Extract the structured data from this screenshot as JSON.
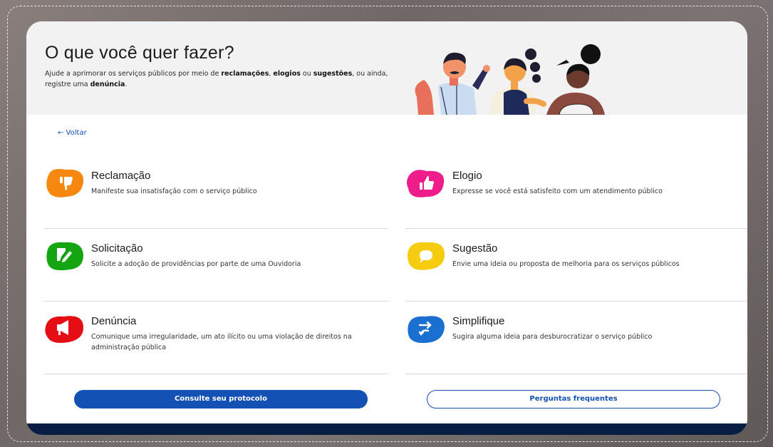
{
  "header": {
    "title": "O que você quer fazer?",
    "subtitle_parts": {
      "p1": "Ajude a aprimorar os serviços públicos por meio de ",
      "b1": "reclamações",
      "p2": ", ",
      "b2": "elogios",
      "p3": " ou ",
      "b3": "sugestões",
      "p4": ", ou ainda, registre uma ",
      "b4": "denúncia",
      "p5": "."
    }
  },
  "nav": {
    "back_label": "← Voltar"
  },
  "options": [
    {
      "title": "Reclamação",
      "description": "Manifeste sua insatisfação com o serviço público",
      "color": "#f7880f",
      "icon": "thumbs-down-icon"
    },
    {
      "title": "Elogio",
      "description": "Expresse se você está satisfeito com um atendimento público",
      "color": "#ef1d8c",
      "icon": "thumbs-up-icon"
    },
    {
      "title": "Solicitação",
      "description": "Solicite a adoção de providências por parte de uma Ouvidoria",
      "color": "#16a512",
      "icon": "document-edit-icon"
    },
    {
      "title": "Sugestão",
      "description": "Envie uma ideia ou proposta de melhoria para os serviços públicos",
      "color": "#f6cc10",
      "icon": "chat-bubble-icon"
    },
    {
      "title": "Denúncia",
      "description": "Comunique uma irregularidade, um ato ilícito ou uma violação de direitos na administração pública",
      "color": "#e40e14",
      "icon": "megaphone-icon"
    },
    {
      "title": "Simplifique",
      "description": "Sugira alguma ideia para desburocratizar o serviço público",
      "color": "#1a6fd1",
      "icon": "shuffle-arrows-icon"
    }
  ],
  "actions": {
    "protocol_label": "Consulte seu protocolo",
    "faq_label": "Perguntas frequentes"
  },
  "colors": {
    "primary": "#1351b4",
    "footer": "#071d41",
    "hero_bg": "#f2f2f2"
  }
}
